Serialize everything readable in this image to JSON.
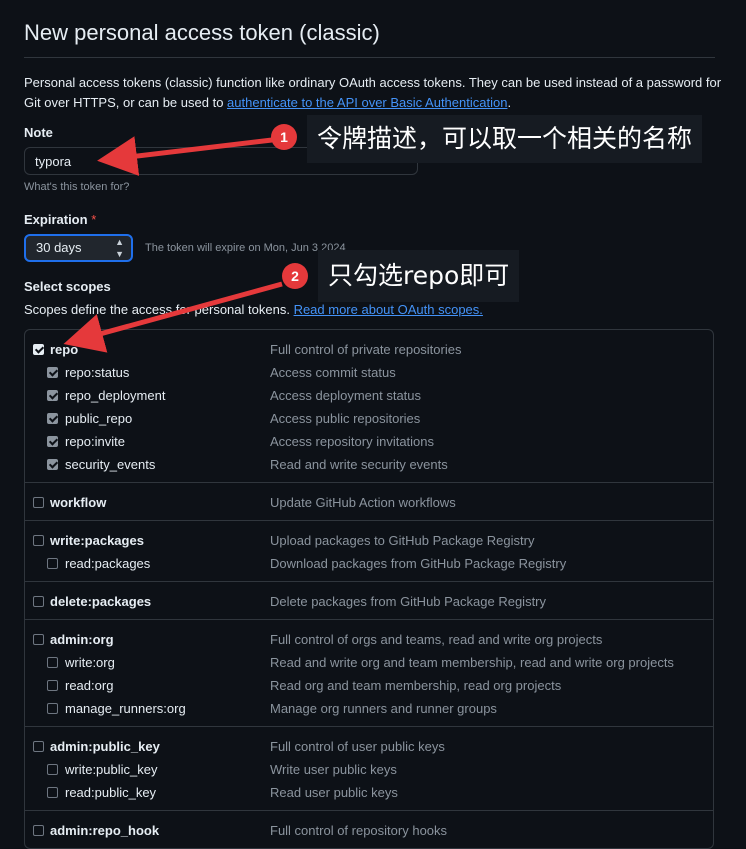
{
  "page": {
    "title": "New personal access token (classic)",
    "intro_text": "Personal access tokens (classic) function like ordinary OAuth access tokens. They can be used instead of a password for Git over HTTPS, or can be used to ",
    "intro_link": "authenticate to the API over Basic Authentication",
    "intro_end": "."
  },
  "note": {
    "label": "Note",
    "value": "typora",
    "hint": "What's this token for?"
  },
  "expiration": {
    "label": "Expiration",
    "required_mark": "*",
    "selected": "30 days",
    "hint": "The token will expire on Mon, Jun 3 2024"
  },
  "scopes": {
    "label": "Select scopes",
    "description": "Scopes define the access for personal tokens.",
    "link": "Read more about OAuth scopes.",
    "groups": [
      {
        "name": "repo",
        "desc": "Full control of private repositories",
        "checked": true,
        "children": [
          {
            "name": "repo:status",
            "desc": "Access commit status",
            "checked": true
          },
          {
            "name": "repo_deployment",
            "desc": "Access deployment status",
            "checked": true
          },
          {
            "name": "public_repo",
            "desc": "Access public repositories",
            "checked": true
          },
          {
            "name": "repo:invite",
            "desc": "Access repository invitations",
            "checked": true
          },
          {
            "name": "security_events",
            "desc": "Read and write security events",
            "checked": true
          }
        ]
      },
      {
        "name": "workflow",
        "desc": "Update GitHub Action workflows",
        "checked": false,
        "children": []
      },
      {
        "name": "write:packages",
        "desc": "Upload packages to GitHub Package Registry",
        "checked": false,
        "children": [
          {
            "name": "read:packages",
            "desc": "Download packages from GitHub Package Registry",
            "checked": false
          }
        ]
      },
      {
        "name": "delete:packages",
        "desc": "Delete packages from GitHub Package Registry",
        "checked": false,
        "children": []
      },
      {
        "name": "admin:org",
        "desc": "Full control of orgs and teams, read and write org projects",
        "checked": false,
        "children": [
          {
            "name": "write:org",
            "desc": "Read and write org and team membership, read and write org projects",
            "checked": false
          },
          {
            "name": "read:org",
            "desc": "Read org and team membership, read org projects",
            "checked": false
          },
          {
            "name": "manage_runners:org",
            "desc": "Manage org runners and runner groups",
            "checked": false
          }
        ]
      },
      {
        "name": "admin:public_key",
        "desc": "Full control of user public keys",
        "checked": false,
        "children": [
          {
            "name": "write:public_key",
            "desc": "Write user public keys",
            "checked": false
          },
          {
            "name": "read:public_key",
            "desc": "Read user public keys",
            "checked": false
          }
        ]
      },
      {
        "name": "admin:repo_hook",
        "desc": "Full control of repository hooks",
        "checked": false,
        "children": []
      }
    ]
  },
  "annotations": {
    "badge1": "1",
    "callout1": "令牌描述，可以取一个相关的名称",
    "badge2": "2",
    "callout2": "只勾选repo即可"
  },
  "colors": {
    "background": "#0d1117",
    "link": "#4493f8",
    "annotation_red": "#e5393b",
    "muted_text": "#8b949e"
  }
}
